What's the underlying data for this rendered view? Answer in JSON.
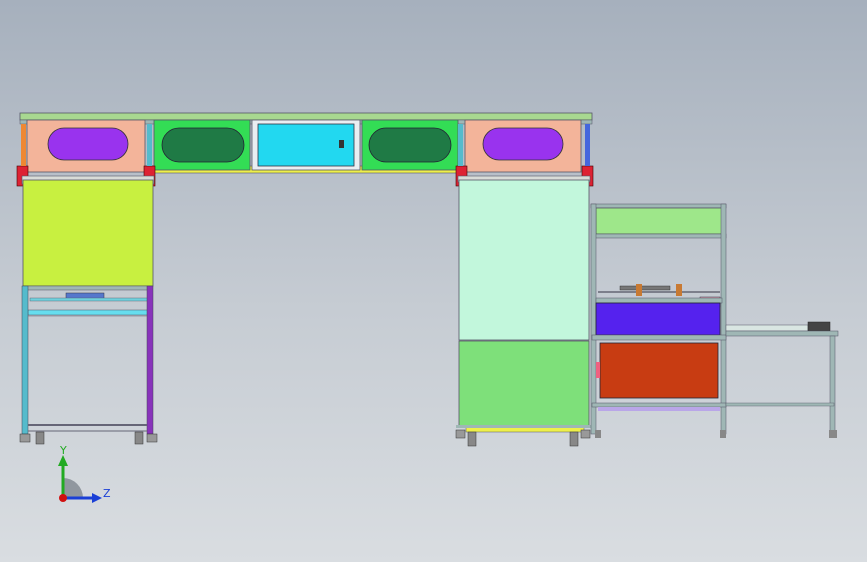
{
  "triad": {
    "y_label": "Y",
    "z_label": "Z",
    "y_color": "#22aa22",
    "z_color": "#1a3fd6",
    "origin_color": "#d01010"
  },
  "colors": {
    "frame": "#9ab3b3",
    "frame_top": "#a9d88a",
    "beam_green": "#33dd55",
    "cyan_panel": "#22d8f0",
    "dark_green_window": "#1f7a45",
    "peach_panel": "#f3b49a",
    "purple_window": "#9933ee",
    "lime_panel": "#c8f040",
    "mint_panel": "#c2f7dc",
    "green_panel": "#7ee07a",
    "blue_panel": "#5522ee",
    "orange_panel": "#c83c12",
    "light_green_panel": "#9ee78a",
    "red_bracket": "#dd2233",
    "violet_post": "#8833bb",
    "cyan_post": "#55bbcc",
    "yellow_strip": "#eef04a"
  }
}
